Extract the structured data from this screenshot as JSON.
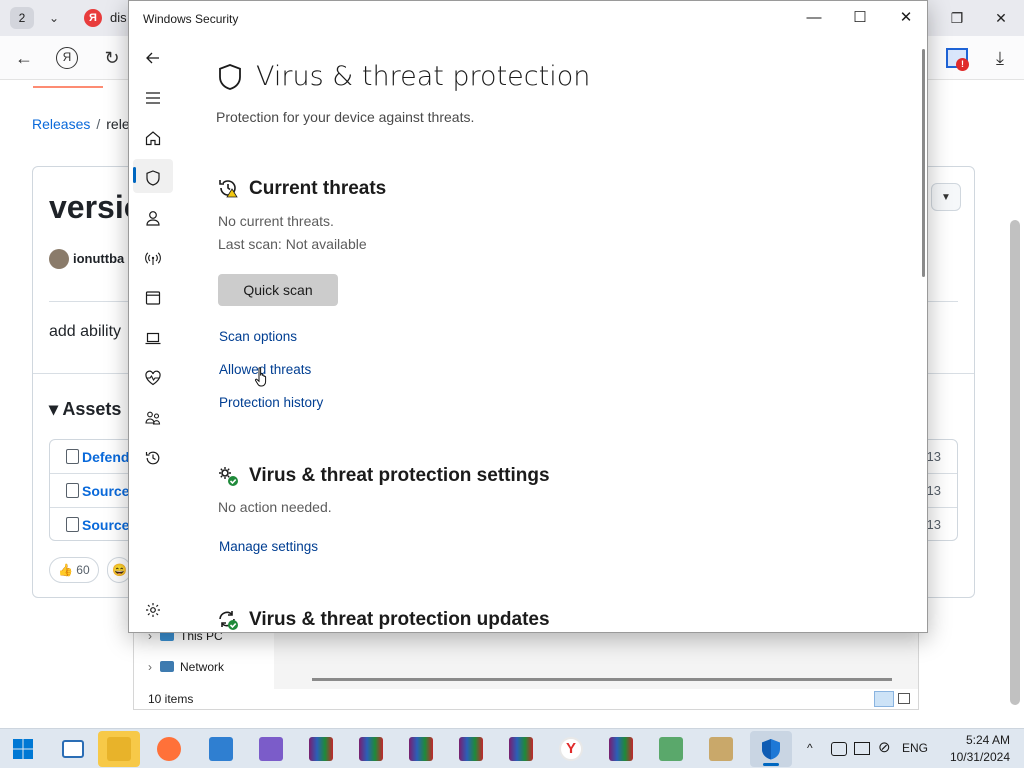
{
  "browser": {
    "tab_count": "2",
    "tab_favicon": "Я",
    "tab_title": "dis",
    "yandex_button": "Я"
  },
  "github": {
    "breadcrumb_root": "Releases",
    "breadcrumb_sep": "/",
    "breadcrumb_rest": "relea",
    "release_title": "versio",
    "author": "ionuttba",
    "note": "add ability",
    "assets_heading": "▾ Assets",
    "assets": [
      {
        "name": "Defend",
        "date": "13"
      },
      {
        "name": "Source",
        "date": "13"
      },
      {
        "name": "Source",
        "date": "13"
      }
    ],
    "reaction_count": "60"
  },
  "explorer": {
    "nav_items": [
      "This PC",
      "Network"
    ],
    "status": "10 items"
  },
  "winsec": {
    "window_title": "Windows Security",
    "page_title": "Virus & threat protection",
    "page_subtitle": "Protection for your device against threats.",
    "current_threats": {
      "title": "Current threats",
      "status": "No current threats.",
      "last_scan": "Last scan: Not available",
      "quick_scan": "Quick scan",
      "links": [
        "Scan options",
        "Allowed threats",
        "Protection history"
      ]
    },
    "settings": {
      "title": "Virus & threat protection settings",
      "status": "No action needed.",
      "link": "Manage settings"
    },
    "updates": {
      "title": "Virus & threat protection updates"
    }
  },
  "taskbar": {
    "language": "ENG",
    "time": "5:24 AM",
    "date": "10/31/2024"
  },
  "colors": {
    "accent": "#0067c0",
    "link": "#003e92",
    "github_link": "#0969da"
  }
}
